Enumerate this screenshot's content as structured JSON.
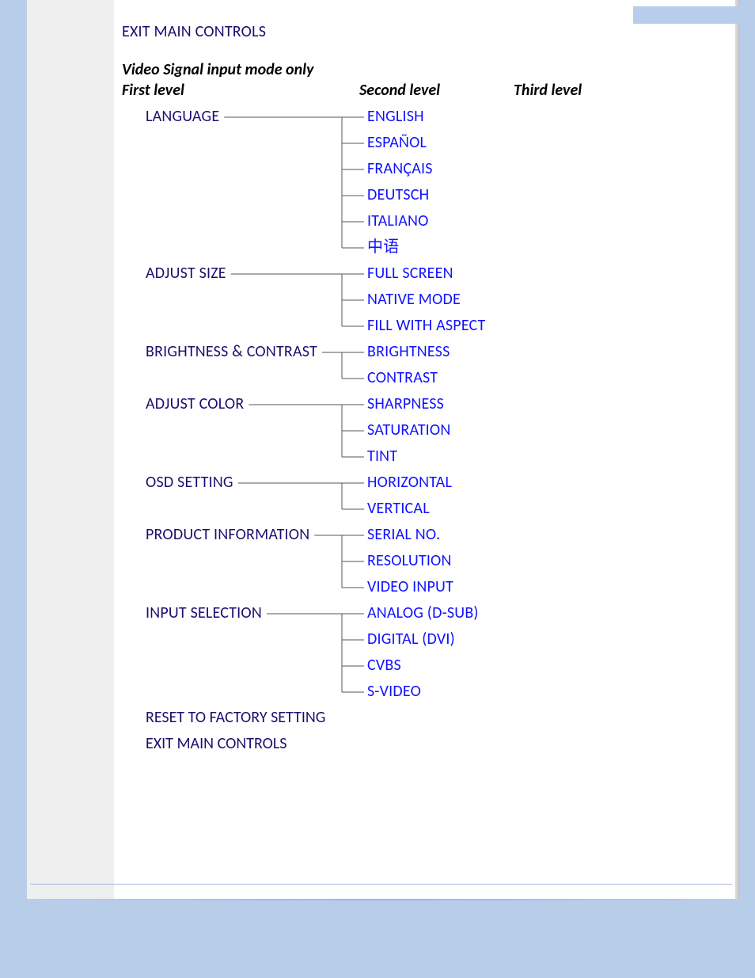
{
  "exit_top": "EXIT MAIN CONTROLS",
  "subtitle": "Video Signal input mode only",
  "headers": {
    "c1": "First level",
    "c2": "Second level",
    "c3": "Third level"
  },
  "menu": [
    {
      "label": "LANGUAGE",
      "children": [
        "ENGLISH",
        "ESPAÑOL",
        "FRANÇAIS",
        "DEUTSCH",
        "ITALIANO",
        "中语"
      ]
    },
    {
      "label": "ADJUST SIZE",
      "children": [
        "FULL SCREEN",
        "NATIVE MODE",
        "FILL WITH ASPECT"
      ]
    },
    {
      "label": "BRIGHTNESS & CONTRAST",
      "children": [
        "BRIGHTNESS",
        "CONTRAST"
      ]
    },
    {
      "label": "ADJUST COLOR",
      "children": [
        "SHARPNESS",
        "SATURATION",
        "TINT"
      ]
    },
    {
      "label": "OSD SETTING",
      "children": [
        "HORIZONTAL",
        "VERTICAL"
      ]
    },
    {
      "label": "PRODUCT INFORMATION",
      "children": [
        "SERIAL NO.",
        "RESOLUTION",
        "VIDEO INPUT"
      ]
    },
    {
      "label": "INPUT SELECTION",
      "children": [
        "ANALOG (D-SUB)",
        "DIGITAL (DVI)",
        "CVBS",
        "S-VIDEO"
      ]
    }
  ],
  "tail": [
    "RESET TO FACTORY SETTING",
    "EXIT MAIN CONTROLS"
  ],
  "colors": {
    "level1": "#1a0f6e",
    "level2": "#1111ff",
    "line": "#555555"
  }
}
